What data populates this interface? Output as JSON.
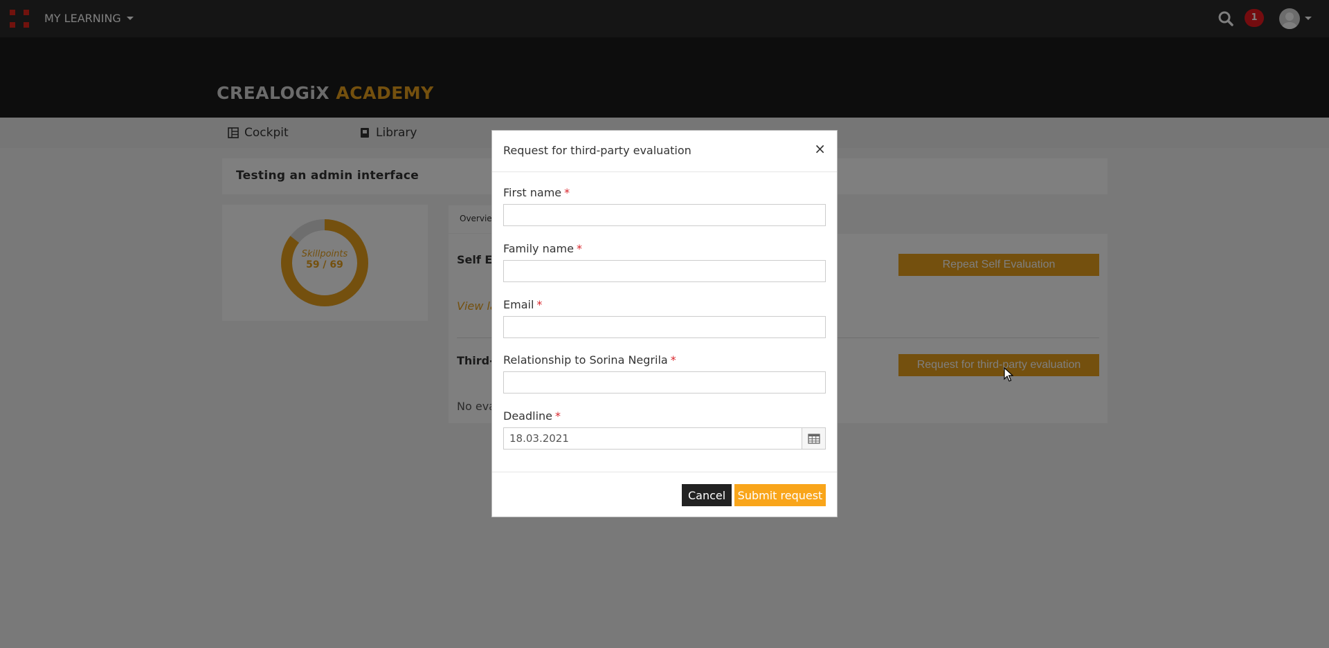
{
  "topbar": {
    "menu_label": "MY LEARNING",
    "notification_count": "1",
    "icons": [
      "apps-grid-icon",
      "search-icon",
      "avatar-icon"
    ],
    "accent_color": "#e3241b"
  },
  "header": {
    "logo_part1": "CREALOGiX",
    "logo_part2": "ACADEMY",
    "logo_color": "#e8a11c"
  },
  "nav": {
    "items": [
      {
        "label": "Cockpit",
        "icon": "grid-icon"
      },
      {
        "label": "Library",
        "icon": "book-icon"
      }
    ]
  },
  "course": {
    "title": "Testing an admin interface",
    "skillpoints_label": "Skillpoints",
    "skillpoints_value": "59 / 69",
    "skillpoints_fraction": 0.855,
    "tab_overview": "Overview",
    "self_eval_heading": "Self Ev",
    "view_link": "View la",
    "repeat_button": "Repeat Self Evaluation",
    "third_party_heading": "Third-p",
    "request_button": "Request for third-party evaluation",
    "no_eval_text": "No eva"
  },
  "modal": {
    "title": "Request for third-party evaluation",
    "close_symbol": "×",
    "fields": {
      "first_name": {
        "label": "First name",
        "value": ""
      },
      "family_name": {
        "label": "Family name",
        "value": ""
      },
      "email": {
        "label": "Email",
        "value": ""
      },
      "relationship": {
        "label": "Relationship to Sorina Negrila",
        "value": ""
      },
      "deadline": {
        "label": "Deadline",
        "value": "18.03.2021"
      }
    },
    "required_marker": "*",
    "cancel_label": "Cancel",
    "submit_label": "Submit request",
    "submit_color": "#f9a51a"
  }
}
